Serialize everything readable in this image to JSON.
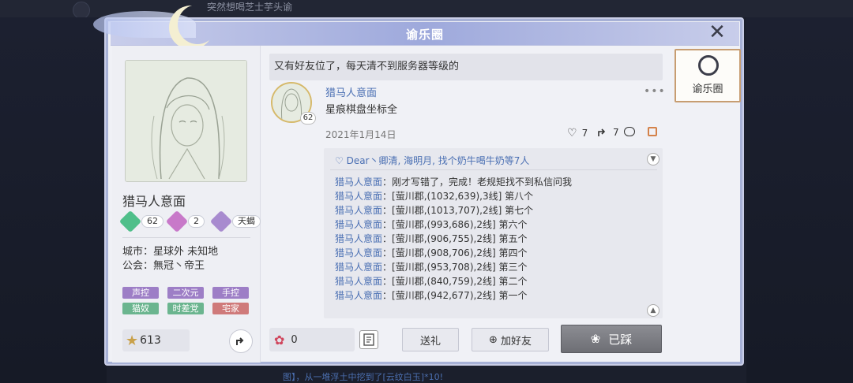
{
  "background": {
    "top_text": "突然想喝芝士芋头谕",
    "bottom_text": "图】，从一堆浮土中挖到了[云纹白玉]*10!"
  },
  "window": {
    "title": "谕乐圈",
    "close_label": "✕",
    "side_tab_label": "谕乐圈"
  },
  "profile": {
    "avatar_signature": "Sample",
    "name": "猎马人意面",
    "stats": [
      {
        "value": "62",
        "color": "#4fbf8a"
      },
      {
        "value": "2",
        "color": "#c879c9"
      },
      {
        "value": "天蝎",
        "color": "#a88bcf"
      }
    ],
    "zodiac_glyph": "♏",
    "city": "城市：星球外 未知地",
    "guild": "公会：無冠丶帝王",
    "tags": [
      {
        "label": "声控",
        "style": "purple"
      },
      {
        "label": "二次元",
        "style": "purple"
      },
      {
        "label": "手控",
        "style": "purple"
      },
      {
        "label": "猫奴",
        "style": "green"
      },
      {
        "label": "时差党",
        "style": "green"
      },
      {
        "label": "宅家",
        "style": "red"
      }
    ],
    "stars": "613"
  },
  "feed": {
    "notice": "又有好友位了，每天清不到服务器等级的",
    "post": {
      "author": "猎马人意面",
      "level": "62",
      "body": "星痕棋盘坐标全",
      "date": "2021年1月14日",
      "likes": "7",
      "shares": "7",
      "more_label": "•••"
    },
    "liked_by": "Dear丶卿清, 海明月, 找个奶牛喝牛奶等7人",
    "comments": [
      {
        "name": "猎马人意面",
        "text": "：刚才写错了，完成！老规矩找不到私信问我"
      },
      {
        "name": "猎马人意面",
        "text": "：[萤川郡,(1032,639),3线] 第八个"
      },
      {
        "name": "猎马人意面",
        "text": "：[萤川郡,(1013,707),2线] 第七个"
      },
      {
        "name": "猎马人意面",
        "text": "：[萤川郡,(993,686),2线] 第六个"
      },
      {
        "name": "猎马人意面",
        "text": "：[萤川郡,(906,755),2线] 第五个"
      },
      {
        "name": "猎马人意面",
        "text": "：[萤川郡,(908,706),2线] 第四个"
      },
      {
        "name": "猎马人意面",
        "text": "：[萤川郡,(953,708),2线] 第三个"
      },
      {
        "name": "猎马人意面",
        "text": "：[萤川郡,(840,759),2线] 第二个"
      },
      {
        "name": "猎马人意面",
        "text": "：[萤川郡,(942,677),2线] 第一个"
      }
    ]
  },
  "footer": {
    "flowers": "0",
    "gift_label": "送礼",
    "add_friend_label": "加好友",
    "visited_label": "已踩"
  },
  "colors": {
    "accent_blue": "#4a6fb3",
    "panel_bg": "#f0f1f6",
    "side_tab_border": "#c79d71"
  }
}
